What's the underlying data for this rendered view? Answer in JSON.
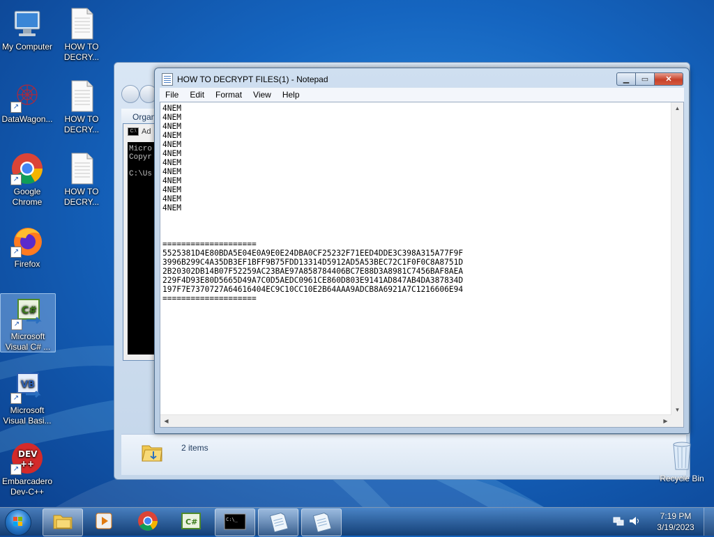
{
  "desktop": {
    "icons": [
      {
        "label": "My Computer"
      },
      {
        "label": "HOW TO DECRY..."
      },
      {
        "label": "DataWagon..."
      },
      {
        "label": "HOW TO DECRY..."
      },
      {
        "label": "Google Chrome"
      },
      {
        "label": "HOW TO DECRY..."
      },
      {
        "label": "Firefox"
      },
      {
        "label": "Microsoft Visual C# ..."
      },
      {
        "label": "Microsoft Visual Basi..."
      },
      {
        "label": "Embarcadero Dev-C++"
      },
      {
        "label": "Recycle Bin"
      }
    ]
  },
  "explorer": {
    "organize_label": "Organ",
    "item_count": "2 items"
  },
  "cmd": {
    "title": "Ad",
    "console_text": "Micro\nCopyr\n\nC:\\Us"
  },
  "notepad": {
    "title": "HOW TO DECRYPT FILES(1) - Notepad",
    "menu": [
      "File",
      "Edit",
      "Format",
      "View",
      "Help"
    ],
    "content": "4NEM\n4NEM\n4NEM\n4NEM\n4NEM\n4NEM\n4NEM\n4NEM\n4NEM\n4NEM\n4NEM\n4NEM\n\n\n\n====================\n5525381D4E80BDA5E04E0A9E0E24DBA0CF25232F71EED4DDE3C398A315A77F9F\n3996B299C4A35DB3EF1BFF9B75FDD13314D5912AD5A53BEC72C1F0F0C8A8751D\n2B20302DB14B07F52259AC23BAE97A858784406BC7E88D3A8981C7456BAF8AEA\n229F4D93E80D5665D49A7C0D5AEDC0961CE860D803E9141AD847AB4DA387834D\n197F7E7370727A64616404EC9C10CC10E2B64AAA9ADCB8A6921A7C1216606E94\n===================="
  },
  "taskbar": {
    "time": "7:19 PM",
    "date": "3/19/2023"
  },
  "colors": {
    "accent": "#1565c0",
    "close_button": "#c7412a"
  }
}
